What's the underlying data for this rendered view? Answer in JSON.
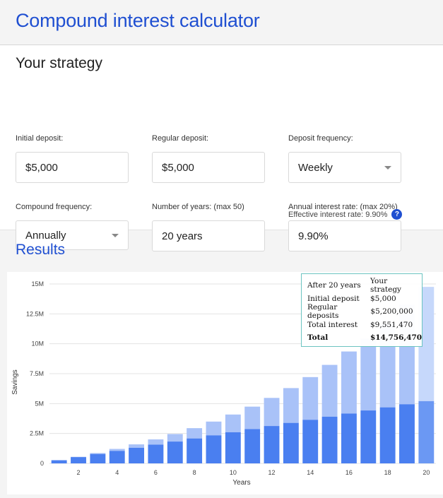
{
  "header": {
    "title": "Compound interest calculator"
  },
  "strategy": {
    "title": "Your strategy",
    "initial_deposit": {
      "label": "Initial deposit:",
      "value": "$5,000"
    },
    "regular_deposit": {
      "label": "Regular deposit:",
      "value": "$5,000"
    },
    "deposit_frequency": {
      "label": "Deposit frequency:",
      "value": "Weekly"
    },
    "compound_frequency": {
      "label": "Compound frequency:",
      "value": "Annually"
    },
    "years": {
      "label": "Number of years: (max 50)",
      "value": "20 years"
    },
    "interest_rate": {
      "label": "Annual interest rate: (max 20%)",
      "value": "9.90%"
    },
    "effective_rate": "Effective interest rate: 9.90%",
    "help_icon_glyph": "?"
  },
  "results": {
    "title": "Results"
  },
  "tooltip": {
    "header_left": "After 20 years",
    "header_right": "Your strategy",
    "rows": [
      {
        "label": "Initial deposit",
        "value": "$5,000"
      },
      {
        "label": "Regular deposits",
        "value": "$5,200,000"
      },
      {
        "label": "Total interest",
        "value": "$9,551,470"
      }
    ],
    "total": {
      "label": "Total",
      "value": "$14,756,470"
    }
  },
  "chart_data": {
    "type": "bar",
    "stacked": true,
    "xlabel": "Years",
    "ylabel": "Savings",
    "ylim": [
      0,
      15000000
    ],
    "y_ticks": [
      0,
      2500000,
      5000000,
      7500000,
      10000000,
      12500000,
      15000000
    ],
    "y_tick_labels": [
      "0",
      "2.5M",
      "5M",
      "7.5M",
      "10M",
      "12.5M",
      "15M"
    ],
    "x": [
      1,
      2,
      3,
      4,
      5,
      6,
      7,
      8,
      9,
      10,
      11,
      12,
      13,
      14,
      15,
      16,
      17,
      18,
      19,
      20
    ],
    "x_tick_labels": [
      "2",
      "4",
      "6",
      "8",
      "10",
      "12",
      "14",
      "16",
      "18",
      "20"
    ],
    "colors": {
      "deposits": "#4a7ff0",
      "interest": "#a9c2f8",
      "highlight_deposits": "#6b98f3",
      "highlight_interest": "#c6d8fb"
    },
    "highlighted_x": 20,
    "series": [
      {
        "key": "deposits",
        "values": [
          265000,
          525000,
          785000,
          1045000,
          1305000,
          1565000,
          1825000,
          2085000,
          2345000,
          2605000,
          2865000,
          3125000,
          3385000,
          3645000,
          3905000,
          4165000,
          4425000,
          4685000,
          4945000,
          5205000
        ]
      },
      {
        "key": "interest",
        "values": [
          0,
          26000,
          80000,
          165000,
          285000,
          440000,
          630000,
          860000,
          1150000,
          1480000,
          1880000,
          2350000,
          2910000,
          3570000,
          4330000,
          5190000,
          6000000,
          7000000,
          8300000,
          9551470
        ]
      }
    ]
  }
}
